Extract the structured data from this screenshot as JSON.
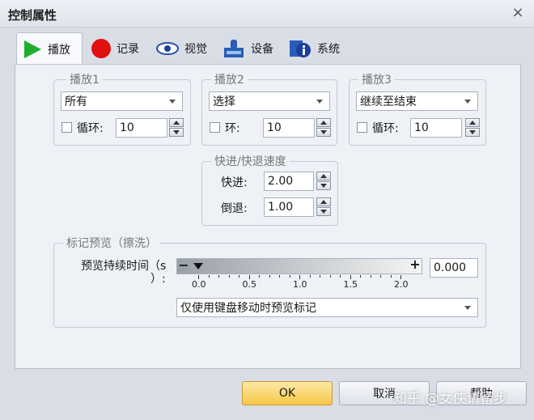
{
  "window": {
    "title": "控制属性",
    "close_glyph": "×"
  },
  "tabs": [
    {
      "label": "播放",
      "icon": "play-icon"
    },
    {
      "label": "记录",
      "icon": "record-icon"
    },
    {
      "label": "视觉",
      "icon": "eye-icon"
    },
    {
      "label": "设备",
      "icon": "device-icon"
    },
    {
      "label": "系统",
      "icon": "system-info-icon"
    }
  ],
  "play1": {
    "title": "播放1",
    "mode": "所有",
    "loop_label": "循环:",
    "loop_value": "10"
  },
  "play2": {
    "title": "播放2",
    "mode": "选择",
    "loop_label": "环:",
    "loop_value": "10"
  },
  "play3": {
    "title": "播放3",
    "mode": "继续至结束",
    "loop_label": "循环:",
    "loop_value": "10"
  },
  "speed": {
    "title": "快进/快退速度",
    "ff_label": "快进:",
    "ff_value": "2.00",
    "rw_label": "倒退:",
    "rw_value": "1.00"
  },
  "preview": {
    "title": "标记预览（擦洗）",
    "duration_label_1": "预览持续时间（s",
    "duration_label_2": "）:",
    "minus": "−",
    "plus": "+",
    "slider_value": 0.0,
    "slider_max": 2.0,
    "ticks": [
      "0.0",
      "0.5",
      "1.0",
      "1.5",
      "2.0"
    ],
    "value": "0.000",
    "option": "仅使用键盘移动时预览标记"
  },
  "buttons": {
    "ok": "OK",
    "cancel": "取消",
    "help": "帮助"
  },
  "watermark": "知乎 @女侠请留步",
  "colors": {
    "accent_ok": "#f6c745",
    "play_green": "#1fae2b",
    "record_red": "#e01010"
  }
}
